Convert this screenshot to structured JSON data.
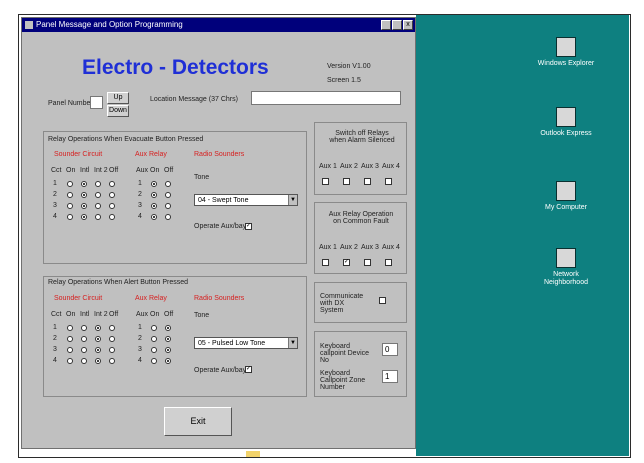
{
  "window": {
    "title": "Panel Message and Option Programming",
    "brand": "Electro - Detectors",
    "version": "Version V1.00",
    "screen": "Screen 1.5",
    "close_glyph": "x"
  },
  "panel_number": {
    "label": "Panel Number",
    "up_label": "Up",
    "down_label": "Down"
  },
  "location_message": {
    "label": "Location Message (37 Chrs)",
    "value": ""
  },
  "evacuate": {
    "title": "Relay Operations When Evacuate Button Pressed",
    "sounder_title": "Sounder Circuit",
    "sounder_headers": [
      "Cct",
      "On",
      "Intl",
      "Int 2",
      "Off"
    ],
    "sounder_rows": [
      {
        "cct": "1",
        "selected": 1
      },
      {
        "cct": "2",
        "selected": 1
      },
      {
        "cct": "3",
        "selected": 1
      },
      {
        "cct": "4",
        "selected": 1
      }
    ],
    "aux_title": "Aux Relay",
    "aux_headers": [
      "Aux",
      "On",
      "Off"
    ],
    "aux_rows": [
      {
        "aux": "1",
        "selected": 0
      },
      {
        "aux": "2",
        "selected": 0
      },
      {
        "aux": "3",
        "selected": 0
      },
      {
        "aux": "4",
        "selected": 0
      }
    ],
    "radio_title": "Radio Sounders",
    "tone_label": "Tone",
    "tone_value": "04 - Swept Tone",
    "operate_aux_label": "Operate Aux/bay",
    "operate_aux_checked": true
  },
  "alert": {
    "title": "Relay Operations When Alert Button Pressed",
    "sounder_title": "Sounder Circuit",
    "sounder_headers": [
      "Cct",
      "On",
      "Intl",
      "Int 2",
      "Off"
    ],
    "sounder_rows": [
      {
        "cct": "1",
        "selected": 2
      },
      {
        "cct": "2",
        "selected": 2
      },
      {
        "cct": "3",
        "selected": 2
      },
      {
        "cct": "4",
        "selected": 2
      }
    ],
    "aux_title": "Aux Relay",
    "aux_headers": [
      "Aux",
      "On",
      "Off"
    ],
    "aux_rows": [
      {
        "aux": "1",
        "selected": 1
      },
      {
        "aux": "2",
        "selected": 1
      },
      {
        "aux": "3",
        "selected": 1
      },
      {
        "aux": "4",
        "selected": 1
      }
    ],
    "radio_title": "Radio Sounders",
    "tone_label": "Tone",
    "tone_value": "05 - Pulsed Low Tone",
    "operate_aux_label": "Operate Aux/bay",
    "operate_aux_checked": true
  },
  "alarm_silenced": {
    "title": "Switch off Relays when Alarm Silenced",
    "labels": [
      "Aux 1",
      "Aux 2",
      "Aux 3",
      "Aux 4"
    ],
    "checked": [
      false,
      false,
      false,
      false
    ]
  },
  "common_fault": {
    "title": "Aux Relay Operation on Common Fault",
    "labels": [
      "Aux 1",
      "Aux 2",
      "Aux 3",
      "Aux 4"
    ],
    "checked": [
      false,
      true,
      false,
      false
    ]
  },
  "communicate": {
    "label": "Communicate with DX System",
    "checked": false
  },
  "callpoints": {
    "device_label": "Keyboard callpoint Device No",
    "device_value": "0",
    "zone_label": "Keyboard Callpoint Zone Number",
    "zone_value": "1"
  },
  "exit_label": "Exit",
  "desktop_icons": [
    {
      "label": "Windows Explorer",
      "icon": "folder-icon"
    },
    {
      "label": "Outlook Express",
      "icon": "mail-icon"
    },
    {
      "label": "My Computer",
      "icon": "computer-icon"
    },
    {
      "label": "Network Neighborhood",
      "icon": "network-icon"
    }
  ]
}
